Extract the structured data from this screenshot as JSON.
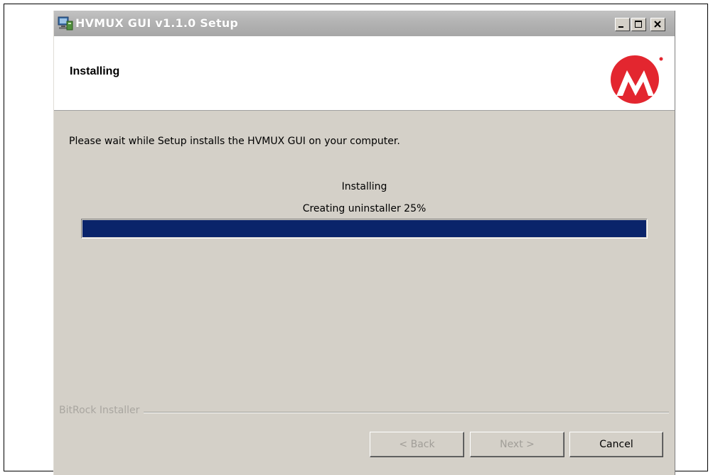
{
  "window": {
    "title": "HVMUX GUI v1.1.0 Setup",
    "app_icon": "installer-computer-icon",
    "controls": [
      "minimize-icon",
      "maximize-icon",
      "close-icon"
    ]
  },
  "header": {
    "title": "Installing",
    "logo": "microchip-logo"
  },
  "body": {
    "message": "Please wait while Setup installs the HVMUX GUI on your computer."
  },
  "progress": {
    "title": "Installing",
    "status": "Creating uninstaller 25%",
    "fill_fraction": 1.0,
    "fill_color": "#0a246a"
  },
  "footer": {
    "brand": "BitRock Installer",
    "back_label": "< Back",
    "next_label": "Next >",
    "cancel_label": "Cancel"
  },
  "colors": {
    "dialog_bg": "#d4d0c8",
    "logo_red": "#e3262f"
  }
}
